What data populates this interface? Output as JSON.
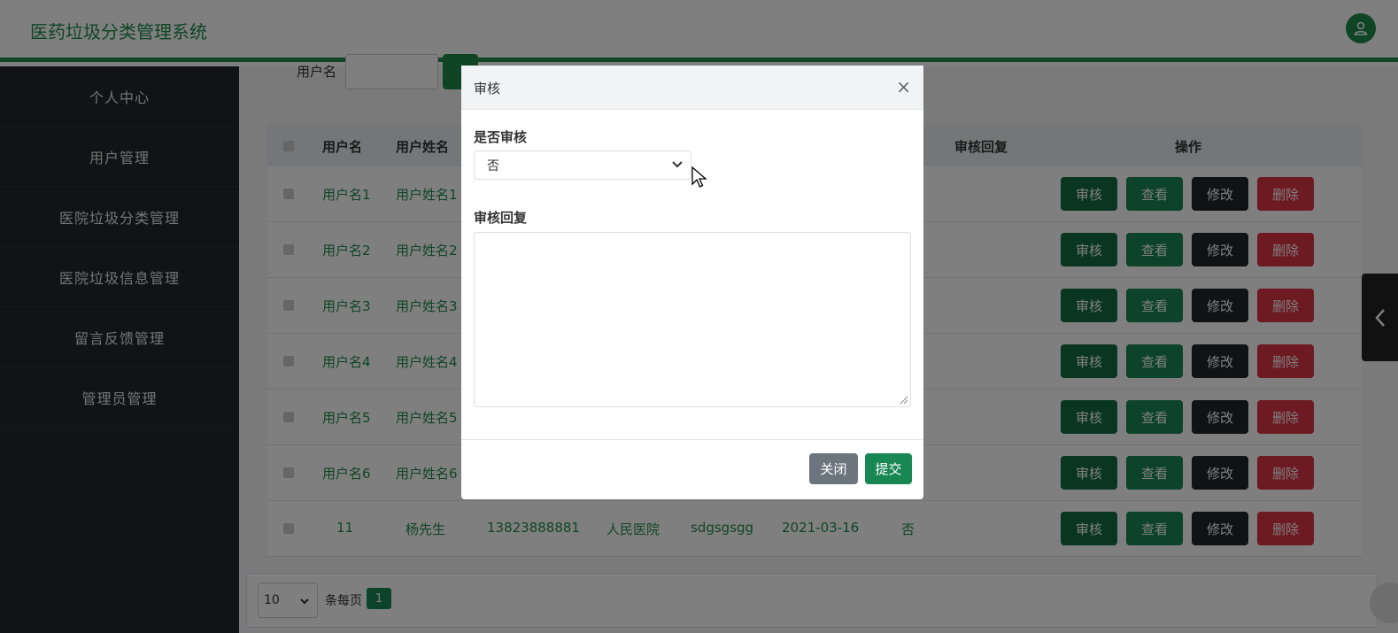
{
  "app": {
    "title": "医药垃圾分类管理系统"
  },
  "sidebar": {
    "items": [
      {
        "label": "个人中心"
      },
      {
        "label": "用户管理"
      },
      {
        "label": "医院垃圾分类管理"
      },
      {
        "label": "医院垃圾信息管理"
      },
      {
        "label": "留言反馈管理"
      },
      {
        "label": "管理员管理"
      }
    ]
  },
  "search": {
    "label": "用户名"
  },
  "table": {
    "headers": {
      "c1": "用户名",
      "c2": "用户姓名",
      "c3": "审核回复",
      "c4": "操作"
    },
    "rows": [
      {
        "c1": "用户名1",
        "c2": "用户姓名1"
      },
      {
        "c1": "用户名2",
        "c2": "用户姓名2"
      },
      {
        "c1": "用户名3",
        "c2": "用户姓名3"
      },
      {
        "c1": "用户名4",
        "c2": "用户姓名4"
      },
      {
        "c1": "用户名5",
        "c2": "用户姓名5"
      },
      {
        "c1": "用户名6",
        "c2": "用户姓名6"
      },
      {
        "c1": "11",
        "c2": "杨先生",
        "phone": "13823888881",
        "hospital": "人民医院",
        "address": "sdgsgsgg",
        "date": "2021-03-16",
        "status": "否"
      }
    ],
    "actions": {
      "audit": "审核",
      "view": "查看",
      "edit": "修改",
      "delete": "删除"
    }
  },
  "pager": {
    "page_size": "10",
    "per_page_label": "条每页",
    "current_page": "1"
  },
  "modal": {
    "title": "审核",
    "close_symbol": "×",
    "audit_label": "是否审核",
    "audit_value": "否",
    "reply_label": "审核回复",
    "close_button": "关闭",
    "submit_button": "提交"
  }
}
